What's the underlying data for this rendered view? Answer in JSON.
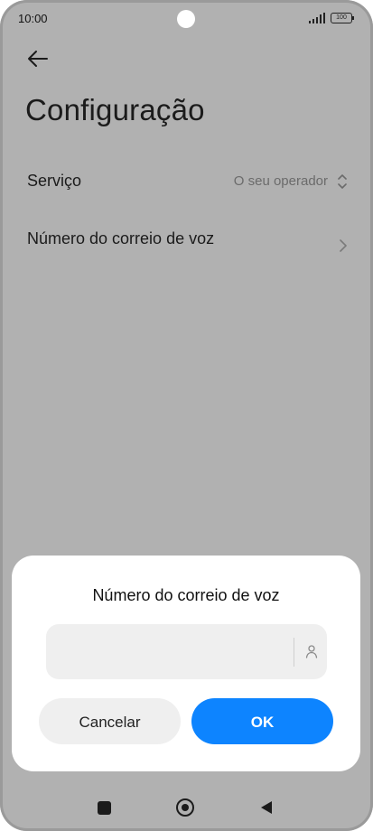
{
  "status_bar": {
    "time": "10:00",
    "battery": "100"
  },
  "header": {
    "title": "Configuração"
  },
  "settings": {
    "service": {
      "label": "Serviço",
      "value": "O seu operador"
    },
    "voicemail": {
      "label": "Número do correio de voz"
    }
  },
  "dialog": {
    "title": "Número do correio de voz",
    "input_value": "",
    "cancel_label": "Cancelar",
    "ok_label": "OK"
  },
  "colors": {
    "accent": "#0d84ff",
    "dim_background": "#b1b1b1"
  },
  "icons": {
    "back": "arrow-left-icon",
    "service_picker": "chevron-up-down-icon",
    "voicemail_chevron": "chevron-right-icon",
    "contact": "contact-person-icon",
    "nav_recent": "square-icon",
    "nav_home": "circle-icon",
    "nav_back": "triangle-back-icon"
  }
}
